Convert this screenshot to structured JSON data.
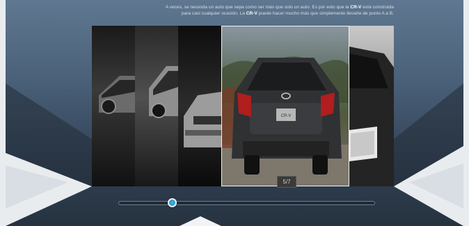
{
  "caption": {
    "line1_a": "A veces, se necesita un auto que sepa como ser más que solo un auto. Es por esto que la ",
    "model": "CR-V",
    "line1_b": " está construida",
    "line2_a": "para casi cualquier ocasión. La ",
    "line2_b": " puede hacer mucho más que simplemente llevarte de punto A a B."
  },
  "gallery": {
    "counter": "5/7",
    "plate_text": "CR-V",
    "panels": [
      "photo-1",
      "photo-2",
      "photo-3",
      "photo-5-active",
      "photo-6"
    ]
  },
  "slider": {
    "position_fraction": 0.2
  },
  "colors": {
    "background_top": "#5f7790",
    "background_bottom": "#26323f",
    "thumb_accent": "#2c8fcc"
  }
}
